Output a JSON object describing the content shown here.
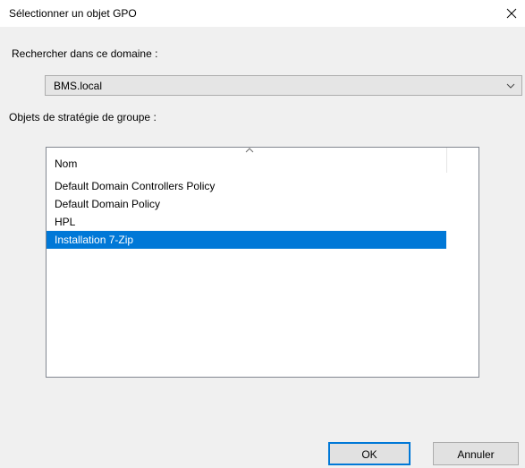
{
  "window": {
    "title": "Sélectionner un objet GPO",
    "close_icon": "close-icon"
  },
  "domain": {
    "label": "Rechercher dans ce domaine :",
    "selected": "BMS.local",
    "dropdown_icon": "chevron-down-icon"
  },
  "gpo_list": {
    "label": "Objets de stratégie de groupe :",
    "column_header": "Nom",
    "sort_icon": "sort-ascending-icon",
    "items": [
      {
        "name": "Default Domain Controllers Policy",
        "selected": false
      },
      {
        "name": "Default Domain Policy",
        "selected": false
      },
      {
        "name": "HPL",
        "selected": false
      },
      {
        "name": "Installation 7-Zip",
        "selected": true
      }
    ]
  },
  "buttons": {
    "ok": "OK",
    "cancel": "Annuler"
  },
  "colors": {
    "selection": "#0078d7",
    "dialog_bg": "#f0f0f0",
    "titlebar_bg": "#ffffff"
  }
}
